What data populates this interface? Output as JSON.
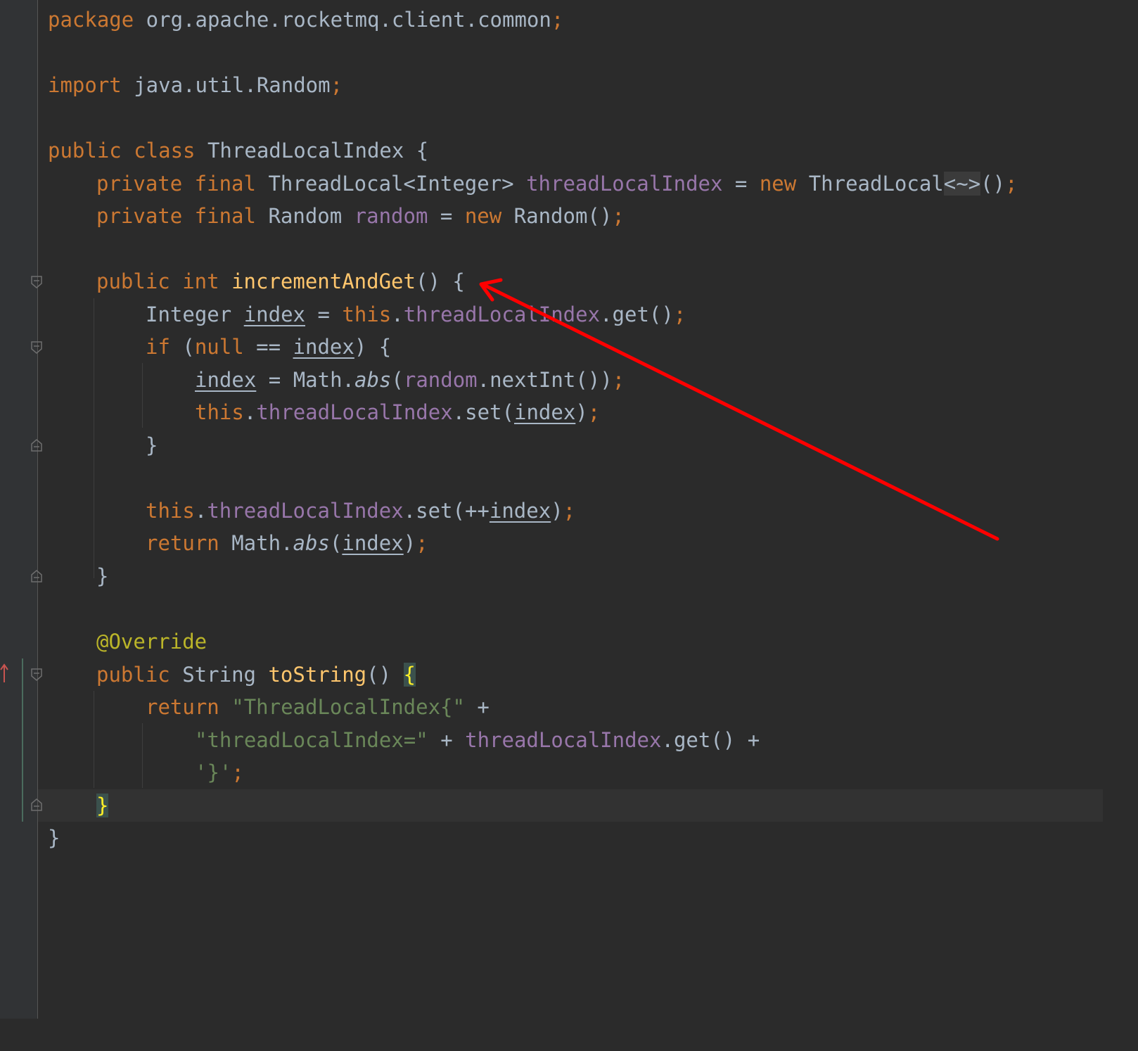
{
  "editor": {
    "language": "Java",
    "theme": "dark"
  },
  "code": {
    "l1": {
      "kw": "package",
      "rest": " org.apache.rocketmq.client.common",
      "semi": ";"
    },
    "l2": {
      "kw": "import",
      "rest": " java.util.Random",
      "semi": ";"
    },
    "l3": {
      "kw": "public class",
      "rest": " ThreadLocalIndex {"
    },
    "l4": {
      "kw1": "private final",
      "t1": " ThreadLocal<Integer> ",
      "f1": "threadLocalIndex",
      "t2": " = ",
      "kw2": "new",
      "t3": " ThreadLocal",
      "diamond": "<~>",
      "t4": "()",
      "semi": ";"
    },
    "l5": {
      "kw1": "private final",
      "t1": " Random ",
      "f1": "random",
      "t2": " = ",
      "kw2": "new",
      "t3": " Random()",
      "semi": ";"
    },
    "l6": {
      "kw": "public int",
      "sp": " ",
      "meth": "incrementAndGet",
      "rest": "() {"
    },
    "l7": {
      "t1": "Integer ",
      "v1": "index",
      "t2": " = ",
      "kw": "this",
      "dot": ".",
      "f1": "threadLocalIndex",
      "t3": ".get()",
      "semi": ";"
    },
    "l8": {
      "kw": "if",
      "t1": " (",
      "kw2": "null",
      "t2": " == ",
      "v1": "index",
      "t3": ") {"
    },
    "l9": {
      "v1": "index",
      "t1": " = Math.",
      "it": "abs",
      "t2": "(",
      "f1": "random",
      "t3": ".nextInt())",
      "semi": ";"
    },
    "l10": {
      "kw": "this",
      "dot": ".",
      "f1": "threadLocalIndex",
      "t1": ".set(",
      "v1": "index",
      "t2": ")",
      "semi": ";"
    },
    "l11": {
      "t1": "}"
    },
    "l12": {
      "kw": "this",
      "dot": ".",
      "f1": "threadLocalIndex",
      "t1": ".set(++",
      "v1": "index",
      "t2": ")",
      "semi": ";"
    },
    "l13": {
      "kw": "return",
      "t1": " Math.",
      "it": "abs",
      "t2": "(",
      "v1": "index",
      "t3": ")",
      "semi": ";"
    },
    "l14": {
      "t1": "}"
    },
    "l15": {
      "ann": "@Override"
    },
    "l16": {
      "kw": "public",
      "t1": " String ",
      "meth": "toString",
      "t2": "() ",
      "brace": "{"
    },
    "l17": {
      "kw": "return",
      "sp": " ",
      "s1": "\"ThreadLocalIndex{\"",
      "t1": " +"
    },
    "l18": {
      "s1": "\"threadLocalIndex=\"",
      "t1": " + ",
      "f1": "threadLocalIndex",
      "t2": ".get() +"
    },
    "l19": {
      "s1": "'}'",
      "semi": ";"
    },
    "l20": {
      "brace": "}"
    },
    "l21": {
      "t1": "}"
    }
  },
  "annotation": {
    "arrow_color": "#ff0000",
    "points_to": "incrementAndGet"
  }
}
